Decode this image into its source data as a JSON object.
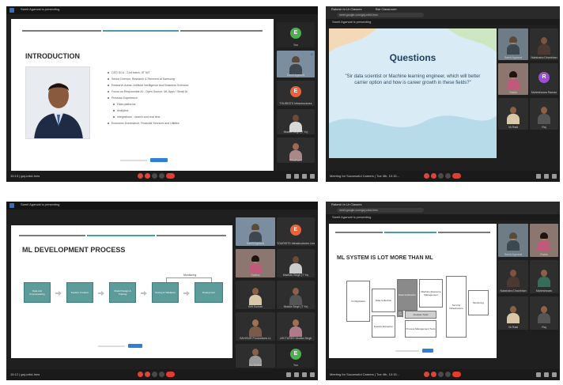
{
  "panels": {
    "p1": {
      "window_title": "Samit Agarwal is presenting",
      "slide_title": "INTRODUCTION",
      "bullets": [
        "CEO SCA - 21st batch, IIT NIT",
        "Senior Director, Research & Reinvent at Samsung",
        "Research Areas: Artificial Intelligence And Business Sciences",
        "Focus on Responsible AI - Open Source: ML Apps / Small AI",
        "Previous Experience",
        "Data platforms",
        "Analytics",
        "Integrations - search and real time",
        "Economic Dominance: Financial Services and Utilities"
      ],
      "bullet_sub": [
        false,
        false,
        false,
        false,
        false,
        true,
        true,
        true,
        false
      ],
      "tiles": [
        {
          "name": "You",
          "initial": "E",
          "color": "#4caf50"
        },
        {
          "name": "Samit Agarwal",
          "initial": "",
          "color": ""
        },
        {
          "name": "TOURISTS Infrastructures",
          "initial": "E",
          "color": "#e8623a"
        },
        {
          "name": "Mudda Singh (T Yo)",
          "initial": "",
          "color": ""
        },
        {
          "name": "Shubham",
          "initial": "",
          "color": ""
        }
      ],
      "bottom_label": "15:13 | gaj-cxbd-hms"
    },
    "p2": {
      "tab_label": "Rakesh in Ur Classes",
      "tab_label2": "Bar Classroom",
      "url": "meet.google.com/gaj-cxbd-hms",
      "window_title": "Samit Agarwal is presenting",
      "slide_title": "Questions",
      "question": "\"Sir data scientist or Machine learning engineer, which will better carrier option and how is career growth in these fields?\"",
      "tiles": [
        {
          "name": "Samit Agarwal",
          "initial": "",
          "color": ""
        },
        {
          "name": "Nakshatra Dhanbhan",
          "initial": "",
          "color": ""
        },
        {
          "name": "Rabia",
          "initial": "",
          "color": ""
        },
        {
          "name": "Maheshwara Raman",
          "initial": "R",
          "color": "#9c4fd6"
        },
        {
          "name": "Vk Radi",
          "initial": "",
          "color": ""
        },
        {
          "name": "Raj",
          "initial": "",
          "color": ""
        }
      ],
      "bottom_label": "Meeting for Successful Careers | Tue 4th, 10:15..."
    },
    "p3": {
      "window_title": "Samit Agarwal is presenting",
      "slide_title": "ML DEVELOPMENT PROCESS",
      "monitoring_label": "Monitoring",
      "steps": [
        "Data and Preprocessing",
        "Feature Creation",
        "Model Design & Training",
        "Testing & Validation",
        "Deployment"
      ],
      "tiles": [
        {
          "name": "Samit Agarwal",
          "initial": "",
          "color": ""
        },
        {
          "name": "TOURISTS Infrastructures Limited",
          "initial": "E",
          "color": "#e8623a"
        },
        {
          "name": "Saleha",
          "initial": "",
          "color": ""
        },
        {
          "name": "Madhav Singh (T Yo)",
          "initial": "",
          "color": ""
        },
        {
          "name": "Kriti Kumari",
          "initial": "",
          "color": ""
        },
        {
          "name": "Mudda Singh (T Yo)",
          "initial": "",
          "color": ""
        },
        {
          "name": "SAVIOUR Productions Lt.",
          "initial": "",
          "color": ""
        },
        {
          "name": "LECTURER Mudda Singh",
          "initial": "",
          "color": ""
        },
        {
          "name": "Dr. Sudhir",
          "initial": "",
          "color": ""
        },
        {
          "name": "You",
          "initial": "E",
          "color": "#4caf50"
        }
      ],
      "bottom_label": "15:12 | gaj-cxbd-hms"
    },
    "p4": {
      "tab_label": "Rakesh in Ur Classes",
      "url": "meet.google.com/gaj-cxbd-hms",
      "window_title": "Samit Agarwal is presenting",
      "slide_title": "ML SYSTEM IS LOT MORE THAN ML",
      "boxes": {
        "configuration": "Configuration",
        "data_collection": "Data Collection",
        "data_verification": "Data Verification",
        "machine_resource": "Machine Resource Management",
        "analysis_tools": "Analysis Tools",
        "ml_code": "ML Code",
        "feature_extraction": "Feature Extraction",
        "process_management": "Process Management Tools",
        "serving_infra": "Serving Infrastructure",
        "monitoring": "Monitoring"
      },
      "tiles": [
        {
          "name": "Samit Agarwal",
          "initial": "",
          "color": ""
        },
        {
          "name": "Rabia",
          "initial": "",
          "color": ""
        },
        {
          "name": "Nakshatra Dhanbhan",
          "initial": "",
          "color": ""
        },
        {
          "name": "Maheshwara",
          "initial": "",
          "color": ""
        },
        {
          "name": "Vk Radi",
          "initial": "",
          "color": ""
        },
        {
          "name": "Raj",
          "initial": "",
          "color": ""
        }
      ],
      "bottom_label": "Meeting for Successful Careers | Tue 4th, 10:15..."
    }
  },
  "colors": {
    "accent_blue": "#2f7fd6",
    "slide_bar_gray": "#7a7a7a",
    "slide_bar_teal": "#4a9ab0",
    "end_call_red": "#e43c30",
    "flow_teal": "#5c9c9a"
  }
}
